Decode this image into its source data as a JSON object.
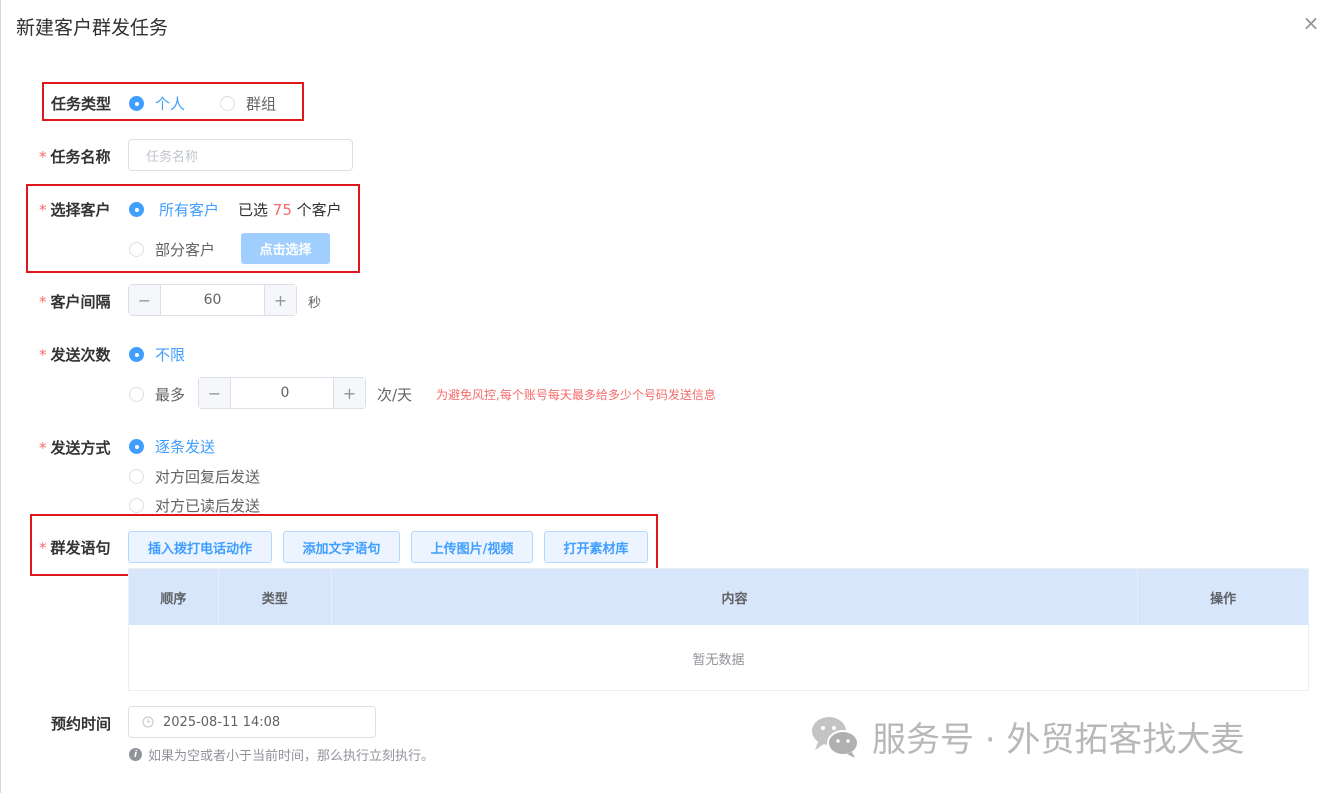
{
  "dialog": {
    "title": "新建客户群发任务",
    "close_glyph": "×"
  },
  "task_type": {
    "label": "任务类型",
    "options": [
      "个人",
      "群组"
    ],
    "selected": "个人"
  },
  "task_name": {
    "required": "*",
    "label": "任务名称",
    "placeholder": "任务名称",
    "value": ""
  },
  "select_customer": {
    "required": "*",
    "label": "选择客户",
    "option_all": "所有客户",
    "selected_prefix": "已选",
    "selected_count": "75",
    "selected_suffix": "个客户",
    "option_partial": "部分客户",
    "choose_button": "点击选择"
  },
  "interval": {
    "required": "*",
    "label": "客户间隔",
    "minus": "−",
    "value": "60",
    "plus": "+",
    "unit": "秒"
  },
  "send_count": {
    "required": "*",
    "label": "发送次数",
    "option_unlimited": "不限",
    "option_max": "最多",
    "minus": "−",
    "value": "0",
    "plus": "+",
    "unit": "次/天",
    "warning": "为避免风控,每个账号每天最多给多少个号码发送信息"
  },
  "send_mode": {
    "required": "*",
    "label": "发送方式",
    "options": [
      "逐条发送",
      "对方回复后发送",
      "对方已读后发送"
    ],
    "selected": "逐条发送"
  },
  "message": {
    "required": "*",
    "label": "群发语句",
    "buttons": [
      "插入拨打电话动作",
      "添加文字语句",
      "上传图片/视频",
      "打开素材库"
    ],
    "table_headers": [
      "顺序",
      "类型",
      "内容",
      "操作"
    ],
    "empty_text": "暂无数据"
  },
  "schedule": {
    "label": "预约时间",
    "value": "2025-08-11 14:08",
    "hint": "如果为空或者小于当前时间，那么执行立刻执行。"
  },
  "watermark": {
    "text": "服务号 · 外贸拓客找大麦"
  },
  "colors": {
    "primary": "#409eff",
    "danger": "#f56c6c",
    "highlight_box": "#e0181e",
    "table_header": "#d7e6fa"
  }
}
